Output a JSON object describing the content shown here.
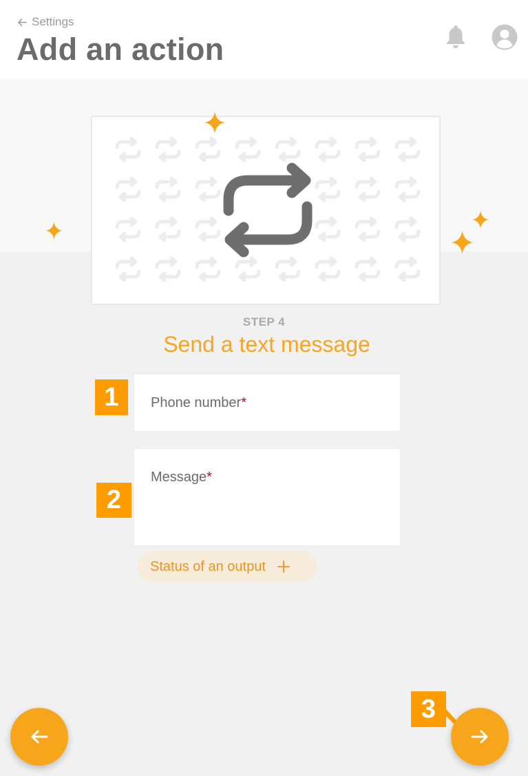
{
  "header": {
    "back_label": "Settings",
    "title": "Add an action"
  },
  "icons": {
    "back": "arrow-left-icon",
    "notifications": "bell-icon",
    "account": "user-avatar-icon",
    "illustration": "repeat-arrows-icon",
    "sparkle": "sparkle-icon",
    "add": "plus-icon",
    "nav_back": "arrow-left-icon",
    "nav_next": "arrow-right-icon"
  },
  "step": {
    "label": "STEP 4",
    "title": "Send a text message"
  },
  "form": {
    "phone": {
      "label": "Phone number",
      "required_mark": "*",
      "value": ""
    },
    "message": {
      "label": "Message",
      "required_mark": "*",
      "value": ""
    }
  },
  "chip": {
    "label": "Status of an output"
  },
  "callouts": [
    "1",
    "2",
    "3"
  ],
  "colors": {
    "accent": "#f7a61b",
    "accent_text": "#f5a623",
    "callout": "#ff9c00",
    "required": "#b0102a",
    "title_text": "#6b6b6b"
  }
}
